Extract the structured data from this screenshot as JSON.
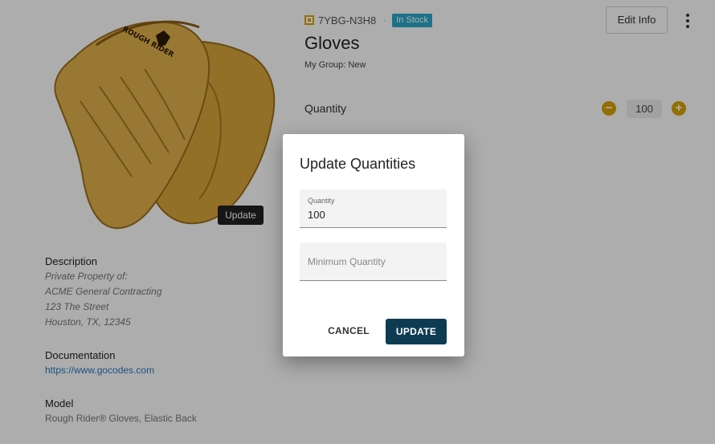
{
  "product": {
    "asset_code": "7YBG-N3H8",
    "status_badge": "In Stock",
    "title": "Gloves",
    "group": "My Group: New",
    "edit_label": "Edit Info",
    "update_photo_label": "Update",
    "image_logo_text": "ROUGH RIDER"
  },
  "quantity": {
    "label": "Quantity",
    "value": "100",
    "minus": "−",
    "plus": "+"
  },
  "details": {
    "description_heading": "Description",
    "description_lines": [
      "Private Property of:",
      "ACME General Contracting",
      "123 The Street",
      "Houston, TX, 12345"
    ],
    "documentation_heading": "Documentation",
    "documentation_link": "https://www.gocodes.com",
    "model_heading": "Model",
    "model_value": "Rough Rider® Gloves, Elastic Back"
  },
  "dialog": {
    "title": "Update Quantities",
    "quantity_field": {
      "label": "Quantity",
      "value": "100"
    },
    "min_quantity_field": {
      "placeholder": "Minimum Quantity"
    },
    "cancel_label": "CANCEL",
    "update_label": "UPDATE"
  },
  "colors": {
    "accent": "#d9a400",
    "badge": "#2aa9c9",
    "primary_button": "#0d3b52",
    "link": "#2a7bbf"
  },
  "icons": {
    "asset_code": "qr-code-icon",
    "more": "more-vert-icon"
  }
}
